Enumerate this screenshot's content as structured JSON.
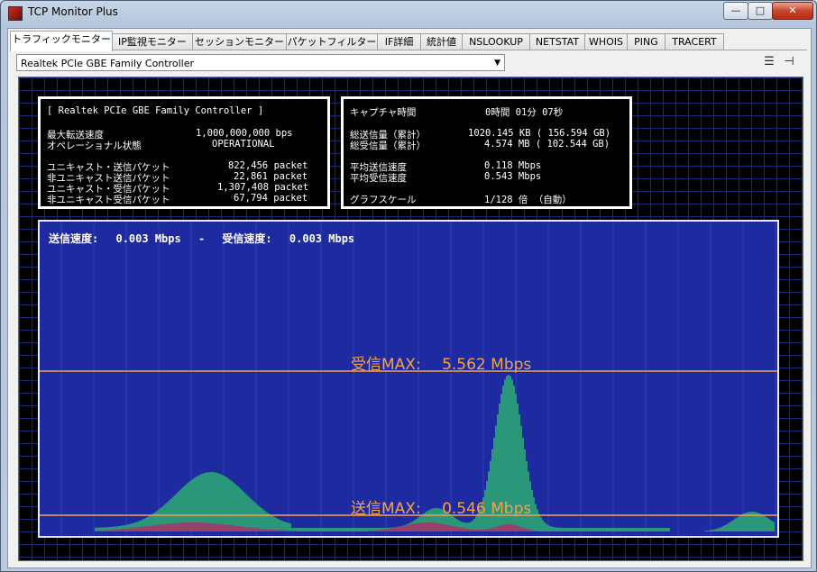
{
  "window": {
    "title": "TCP Monitor Plus",
    "min": "—",
    "max": "□",
    "close": "✕"
  },
  "tabs": [
    "トラフィックモニター",
    "IP監視モニター",
    "セッションモニター",
    "パケットフィルター",
    "IF詳細",
    "統計値",
    "NSLOOKUP",
    "NETSTAT",
    "WHOIS",
    "PING",
    "TRACERT"
  ],
  "active_tab": 0,
  "adapter": {
    "selected": "Realtek PCIe GBE Family Controller"
  },
  "icons": {
    "list": "list-icon",
    "pin": "pin-icon"
  },
  "left_box": {
    "header": "[ Realtek PCIe GBE Family Controller ]",
    "rows": [
      {
        "label": "最大転送速度",
        "value": "1,000,000,000 bps"
      },
      {
        "label": "オペレーショナル状態",
        "value": "OPERATIONAL"
      },
      {
        "label": "ユニキャスト・送信パケット",
        "value": "822,456 packet"
      },
      {
        "label": "非ユニキャスト送信パケット",
        "value": "22,861 packet"
      },
      {
        "label": "ユニキャスト・受信パケット",
        "value": "1,307,408 packet"
      },
      {
        "label": "非ユニキャスト受信パケット",
        "value": "67,794 packet"
      }
    ]
  },
  "right_box": {
    "rows": [
      {
        "label": "キャプチャ時間",
        "value": "0時間 01分 07秒"
      },
      {
        "label": "総送信量（累計）",
        "value": "1020.145 KB ( 156.594 GB)"
      },
      {
        "label": "総受信量（累計）",
        "value": "4.574 MB ( 102.544 GB)"
      },
      {
        "label": "平均送信速度",
        "value": "0.118 Mbps"
      },
      {
        "label": "平均受信速度",
        "value": "0.543 Mbps"
      },
      {
        "label": "グラフスケール",
        "value": "1/128 倍 （自動）"
      }
    ]
  },
  "graph": {
    "send_label": "送信速度:",
    "send_value": "0.003 Mbps",
    "sep": "-",
    "recv_label": "受信速度:",
    "recv_value": "0.003 Mbps",
    "recv_max_label": "受信MAX:",
    "recv_max_value": "5.562 Mbps",
    "send_max_label": "送信MAX:",
    "send_max_value": "0.546 Mbps",
    "colors": {
      "recv": "#2fc46a",
      "send": "#c8345a",
      "maxline": "#f5a24a"
    }
  }
}
